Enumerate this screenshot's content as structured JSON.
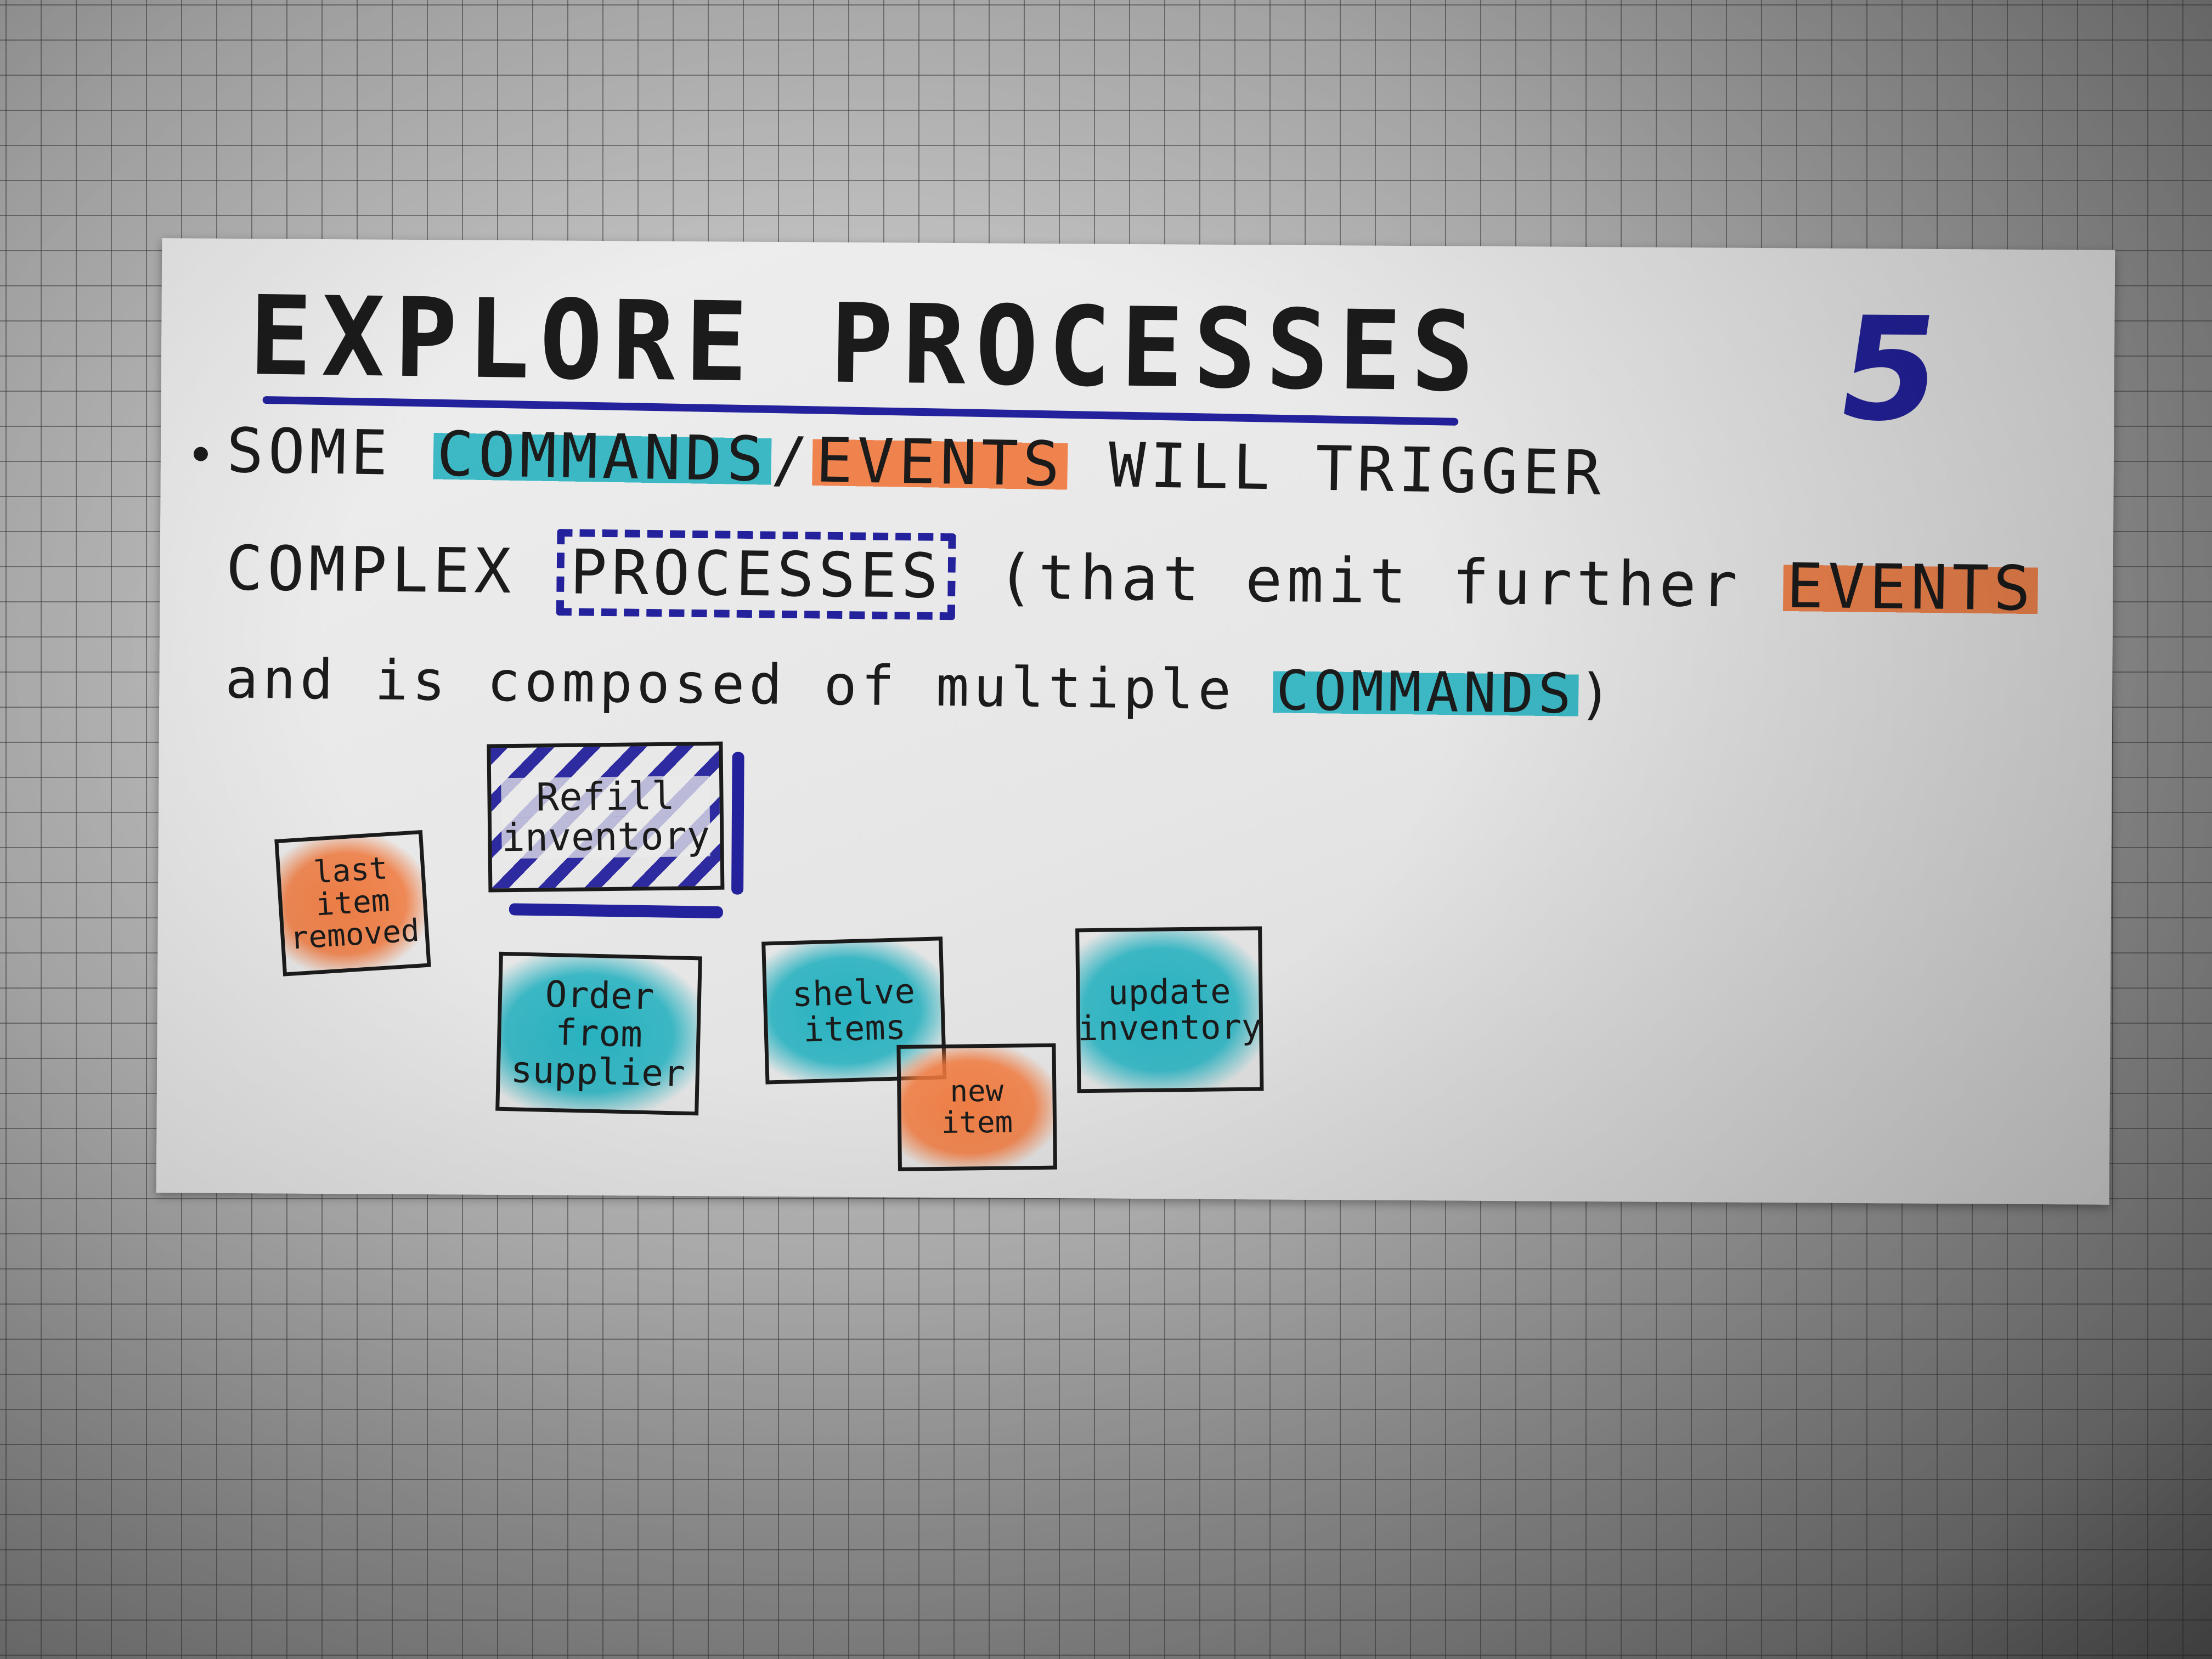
{
  "card": {
    "title": "EXPLORE PROCESSES",
    "page_number": "5",
    "bullet": {
      "line1_prefix": "SOME ",
      "line1_commands": "COMMANDS",
      "line1_slash": "/",
      "line1_events": "EVENTS",
      "line1_suffix": " WILL TRIGGER",
      "line2_prefix": "COMPLEX ",
      "line2_processes": "PROCESSES",
      "line2_suffix": " (that emit further ",
      "line2_events": "EVENTS",
      "line3_prefix": "and is composed of multiple ",
      "line3_commands": "COMMANDS",
      "line3_suffix": ")"
    },
    "stickies": [
      {
        "line1": "last",
        "line2": "item",
        "line3": "removed",
        "kind": "event"
      },
      {
        "line1": "Refill",
        "line2": "inventory",
        "kind": "process"
      },
      {
        "line1": "Order",
        "line2": "from",
        "line3": "supplier",
        "kind": "command"
      },
      {
        "line1": "shelve",
        "line2": "items",
        "kind": "command"
      },
      {
        "line1": "new",
        "line2": "item",
        "kind": "event"
      },
      {
        "line1": "update",
        "line2": "inventory",
        "kind": "command"
      }
    ]
  },
  "colors": {
    "command": "#1eafbe",
    "event": "#f0783c",
    "process": "#23219b",
    "ink": "#1b1b1b"
  }
}
